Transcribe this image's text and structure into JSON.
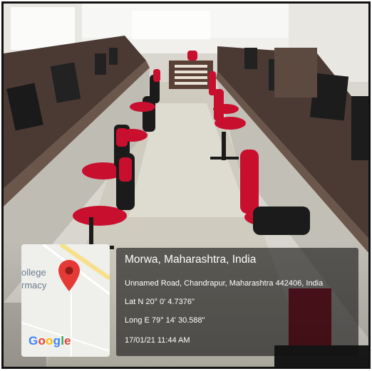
{
  "overlay": {
    "location_title": "Morwa, Maharashtra, India",
    "address": "Unnamed Road, Chandrapur, Maharashtra 442406, India",
    "latitude": "Lat N 20° 0' 4.7376\"",
    "longitude": "Long E 79° 14' 30.588\"",
    "datetime": "17/01/21 11:44 AM"
  },
  "map": {
    "label_line1": "ollege",
    "label_line2": "rmacy",
    "pin_icon": "location-pin-icon",
    "logo_letters": [
      "G",
      "o",
      "o",
      "g",
      "l",
      "e"
    ],
    "logo_colors": [
      "#4285F4",
      "#EA4335",
      "#FBBC05",
      "#4285F4",
      "#34A853",
      "#EA4335"
    ]
  },
  "colors": {
    "chair_red": "#c8102e",
    "chair_black": "#1b1b1b",
    "desk_brown": "#4a3a33"
  }
}
